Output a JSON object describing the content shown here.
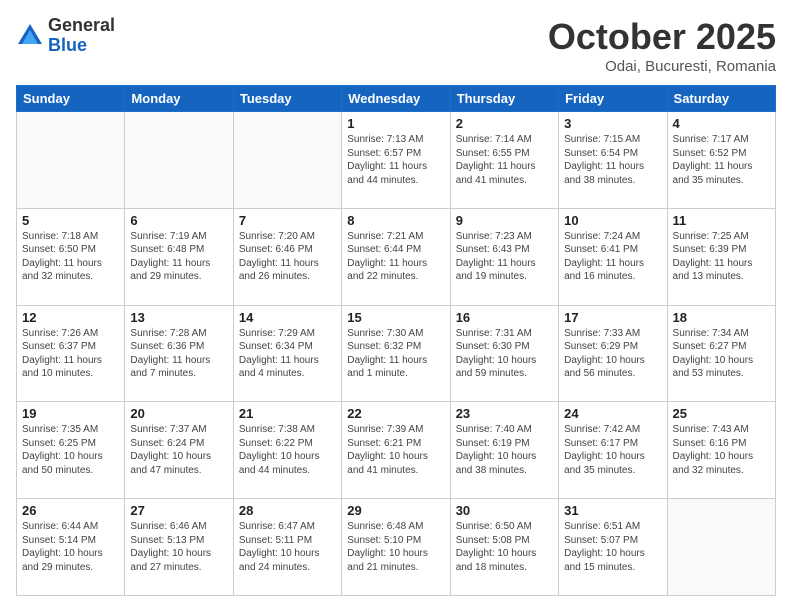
{
  "logo": {
    "general": "General",
    "blue": "Blue"
  },
  "header": {
    "month": "October 2025",
    "location": "Odai, Bucuresti, Romania"
  },
  "days_of_week": [
    "Sunday",
    "Monday",
    "Tuesday",
    "Wednesday",
    "Thursday",
    "Friday",
    "Saturday"
  ],
  "weeks": [
    [
      {
        "day": "",
        "info": ""
      },
      {
        "day": "",
        "info": ""
      },
      {
        "day": "",
        "info": ""
      },
      {
        "day": "1",
        "info": "Sunrise: 7:13 AM\nSunset: 6:57 PM\nDaylight: 11 hours and 44 minutes."
      },
      {
        "day": "2",
        "info": "Sunrise: 7:14 AM\nSunset: 6:55 PM\nDaylight: 11 hours and 41 minutes."
      },
      {
        "day": "3",
        "info": "Sunrise: 7:15 AM\nSunset: 6:54 PM\nDaylight: 11 hours and 38 minutes."
      },
      {
        "day": "4",
        "info": "Sunrise: 7:17 AM\nSunset: 6:52 PM\nDaylight: 11 hours and 35 minutes."
      }
    ],
    [
      {
        "day": "5",
        "info": "Sunrise: 7:18 AM\nSunset: 6:50 PM\nDaylight: 11 hours and 32 minutes."
      },
      {
        "day": "6",
        "info": "Sunrise: 7:19 AM\nSunset: 6:48 PM\nDaylight: 11 hours and 29 minutes."
      },
      {
        "day": "7",
        "info": "Sunrise: 7:20 AM\nSunset: 6:46 PM\nDaylight: 11 hours and 26 minutes."
      },
      {
        "day": "8",
        "info": "Sunrise: 7:21 AM\nSunset: 6:44 PM\nDaylight: 11 hours and 22 minutes."
      },
      {
        "day": "9",
        "info": "Sunrise: 7:23 AM\nSunset: 6:43 PM\nDaylight: 11 hours and 19 minutes."
      },
      {
        "day": "10",
        "info": "Sunrise: 7:24 AM\nSunset: 6:41 PM\nDaylight: 11 hours and 16 minutes."
      },
      {
        "day": "11",
        "info": "Sunrise: 7:25 AM\nSunset: 6:39 PM\nDaylight: 11 hours and 13 minutes."
      }
    ],
    [
      {
        "day": "12",
        "info": "Sunrise: 7:26 AM\nSunset: 6:37 PM\nDaylight: 11 hours and 10 minutes."
      },
      {
        "day": "13",
        "info": "Sunrise: 7:28 AM\nSunset: 6:36 PM\nDaylight: 11 hours and 7 minutes."
      },
      {
        "day": "14",
        "info": "Sunrise: 7:29 AM\nSunset: 6:34 PM\nDaylight: 11 hours and 4 minutes."
      },
      {
        "day": "15",
        "info": "Sunrise: 7:30 AM\nSunset: 6:32 PM\nDaylight: 11 hours and 1 minute."
      },
      {
        "day": "16",
        "info": "Sunrise: 7:31 AM\nSunset: 6:30 PM\nDaylight: 10 hours and 59 minutes."
      },
      {
        "day": "17",
        "info": "Sunrise: 7:33 AM\nSunset: 6:29 PM\nDaylight: 10 hours and 56 minutes."
      },
      {
        "day": "18",
        "info": "Sunrise: 7:34 AM\nSunset: 6:27 PM\nDaylight: 10 hours and 53 minutes."
      }
    ],
    [
      {
        "day": "19",
        "info": "Sunrise: 7:35 AM\nSunset: 6:25 PM\nDaylight: 10 hours and 50 minutes."
      },
      {
        "day": "20",
        "info": "Sunrise: 7:37 AM\nSunset: 6:24 PM\nDaylight: 10 hours and 47 minutes."
      },
      {
        "day": "21",
        "info": "Sunrise: 7:38 AM\nSunset: 6:22 PM\nDaylight: 10 hours and 44 minutes."
      },
      {
        "day": "22",
        "info": "Sunrise: 7:39 AM\nSunset: 6:21 PM\nDaylight: 10 hours and 41 minutes."
      },
      {
        "day": "23",
        "info": "Sunrise: 7:40 AM\nSunset: 6:19 PM\nDaylight: 10 hours and 38 minutes."
      },
      {
        "day": "24",
        "info": "Sunrise: 7:42 AM\nSunset: 6:17 PM\nDaylight: 10 hours and 35 minutes."
      },
      {
        "day": "25",
        "info": "Sunrise: 7:43 AM\nSunset: 6:16 PM\nDaylight: 10 hours and 32 minutes."
      }
    ],
    [
      {
        "day": "26",
        "info": "Sunrise: 6:44 AM\nSunset: 5:14 PM\nDaylight: 10 hours and 29 minutes."
      },
      {
        "day": "27",
        "info": "Sunrise: 6:46 AM\nSunset: 5:13 PM\nDaylight: 10 hours and 27 minutes."
      },
      {
        "day": "28",
        "info": "Sunrise: 6:47 AM\nSunset: 5:11 PM\nDaylight: 10 hours and 24 minutes."
      },
      {
        "day": "29",
        "info": "Sunrise: 6:48 AM\nSunset: 5:10 PM\nDaylight: 10 hours and 21 minutes."
      },
      {
        "day": "30",
        "info": "Sunrise: 6:50 AM\nSunset: 5:08 PM\nDaylight: 10 hours and 18 minutes."
      },
      {
        "day": "31",
        "info": "Sunrise: 6:51 AM\nSunset: 5:07 PM\nDaylight: 10 hours and 15 minutes."
      },
      {
        "day": "",
        "info": ""
      }
    ]
  ]
}
